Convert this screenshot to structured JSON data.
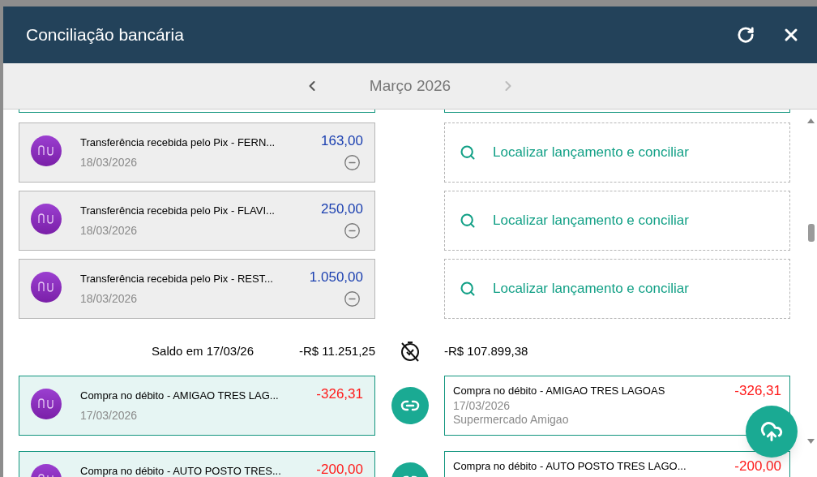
{
  "dialog": {
    "title": "Conciliação bancária",
    "month": "Março 2026",
    "rows": [
      {
        "kind": "entry",
        "matched": false,
        "bank": {
          "description": "Transferência recebida pelo Pix - FERN...",
          "date": "18/03/2026",
          "amount": {
            "text": "163,00",
            "kind": "credit"
          }
        },
        "match": {
          "kind": "search",
          "label": "Localizar lançamento e conciliar"
        }
      },
      {
        "kind": "entry",
        "matched": false,
        "bank": {
          "description": "Transferência recebida pelo Pix - FLAVI...",
          "date": "18/03/2026",
          "amount": {
            "text": "250,00",
            "kind": "credit"
          }
        },
        "match": {
          "kind": "search",
          "label": "Localizar lançamento e conciliar"
        }
      },
      {
        "kind": "entry",
        "matched": false,
        "bank": {
          "description": "Transferência recebida pelo Pix - REST...",
          "date": "18/03/2026",
          "amount": {
            "text": "1.050,00",
            "kind": "credit"
          }
        },
        "match": {
          "kind": "search",
          "label": "Localizar lançamento e conciliar"
        }
      },
      {
        "kind": "balance",
        "label": "Saldo em 17/03/26",
        "bank_balance": "-R$ 11.251,25",
        "book_balance": "-R$ 107.899,38"
      },
      {
        "kind": "entry",
        "matched": true,
        "bank": {
          "description": "Compra no débito - AMIGAO TRES LAG...",
          "date": "17/03/2026",
          "amount": {
            "text": "-326,31",
            "kind": "debit"
          }
        },
        "match": {
          "kind": "entry",
          "description": "Compra no débito - AMIGAO TRES LAGOAS",
          "date": "17/03/2026",
          "party": "Supermercado Amigao",
          "amount": {
            "text": "-326,31",
            "kind": "debit"
          }
        }
      },
      {
        "kind": "entry",
        "matched": true,
        "bank": {
          "description": "Compra no débito - AUTO POSTO TRES...",
          "amount": {
            "text": "-200,00",
            "kind": "debit"
          }
        },
        "match": {
          "kind": "entry",
          "description": "Compra no débito - AUTO POSTO TRES LAGO...",
          "amount": {
            "text": "-200,00",
            "kind": "debit"
          }
        }
      }
    ]
  }
}
